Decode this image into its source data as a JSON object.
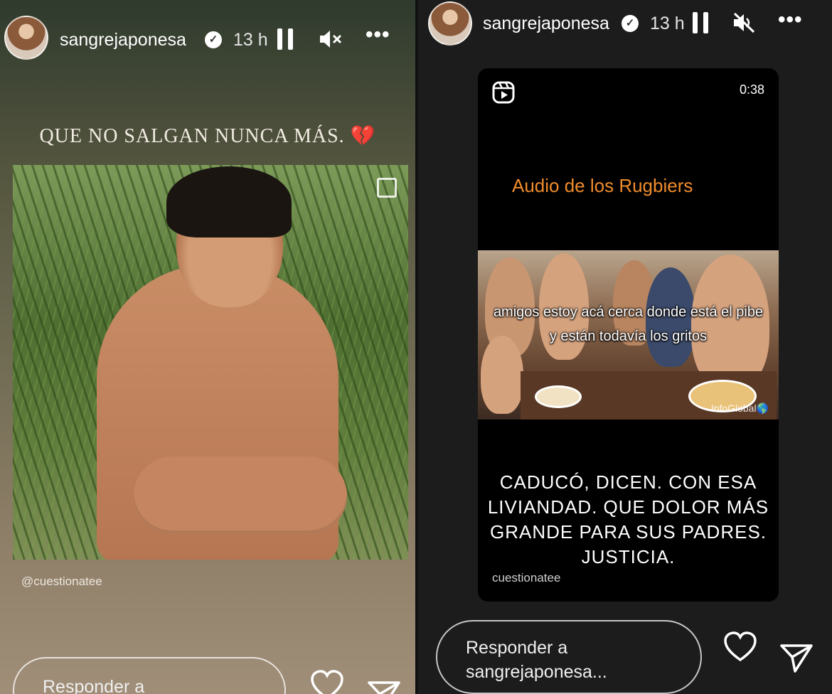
{
  "left_story": {
    "username": "sangrejaponesa",
    "verified_icon": "verified-badge-icon",
    "time": "13 h",
    "caption": "QUE NO SALGAN NUNCA MÁS.",
    "caption_emoji": "💔",
    "mention": "@cuestionatee",
    "reply_placeholder": "Responder a"
  },
  "right_story": {
    "username": "sangrejaponesa",
    "verified_icon": "verified-badge-icon",
    "time": "13 h",
    "reel": {
      "duration": "0:38",
      "title": "Audio de los Rugbiers",
      "overlay_text": "amigos estoy acá cerca donde está el pibe y están todavía los gritos",
      "watermark": "InfoGlobal🌎",
      "caption": "CADUCÓ, DICEN. CON ESA LIVIANDAD. QUE DOLOR MÁS GRANDE PARA SUS PADRES. JUSTICIA.",
      "source": "cuestionatee"
    },
    "reply_placeholder": "Responder a sangrejaponesa..."
  },
  "icons": {
    "pause": "pause-icon",
    "mute": "muted-speaker-icon",
    "more": "more-options-icon",
    "like": "heart-icon",
    "send": "send-icon",
    "reel": "reels-icon"
  },
  "colors": {
    "reel_title": "#f08c2c",
    "right_bg": "#1c1c1c"
  }
}
